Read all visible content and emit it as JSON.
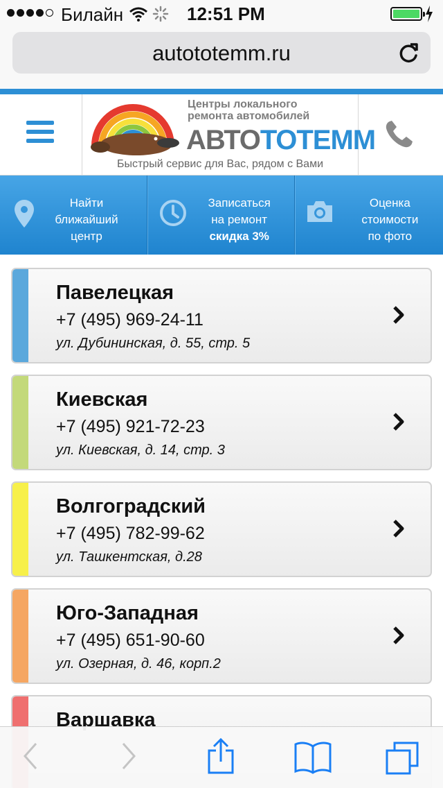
{
  "status_bar": {
    "carrier": "Билайн",
    "time": "12:51 PM",
    "signal_bars": 4,
    "battery_level": 1.0
  },
  "browser": {
    "url": "autototemm.ru",
    "reload_icon": "reload-icon"
  },
  "header": {
    "menu_icon": "hamburger-icon",
    "tagline_line1": "Центры локального",
    "tagline_line2": "ремонта автомобилей",
    "brand_part1": "АВТО",
    "brand_part2": "ТОТЕММ",
    "slogan": "Быстрый сервис для Вас, рядом с Вами",
    "phone_icon": "phone-icon"
  },
  "actions": [
    {
      "icon": "location-pin-icon",
      "line1": "Найти",
      "line2": "ближайший",
      "line3": "центр"
    },
    {
      "icon": "clock-icon",
      "line1": "Записаться",
      "line2": "на ремонт",
      "line3": "скидка 3%"
    },
    {
      "icon": "camera-icon",
      "line1": "Оценка",
      "line2": "стоимости",
      "line3": "по фото"
    }
  ],
  "centers": [
    {
      "name": "Павелецкая",
      "phone": "+7 (495) 969-24-11",
      "address": "ул. Дубининская, д. 55, стр. 5",
      "color": "#5ba8dc"
    },
    {
      "name": "Киевская",
      "phone": "+7 (495) 921-72-23",
      "address": "ул. Киевская, д. 14, стр. 3",
      "color": "#c3d97a"
    },
    {
      "name": "Волгоградский",
      "phone": "+7 (495) 782-99-62",
      "address": "ул. Ташкентская, д.28",
      "color": "#f7f04a"
    },
    {
      "name": "Юго-Западная",
      "phone": "+7 (495) 651-90-60",
      "address": "ул. Озерная, д. 46, корп.2",
      "color": "#f5a662"
    },
    {
      "name": "Варшавка",
      "phone": "",
      "address": "",
      "color": "#ef6f6f"
    }
  ],
  "toolbar": {
    "back_icon": "back-chevron-icon",
    "forward_icon": "forward-chevron-icon",
    "share_icon": "share-icon",
    "bookmarks_icon": "bookmarks-icon",
    "tabs_icon": "tabs-icon"
  },
  "colors": {
    "accent": "#2d8fd5",
    "action_bar_top": "#47a5e6",
    "action_bar_bottom": "#1f84cf"
  }
}
